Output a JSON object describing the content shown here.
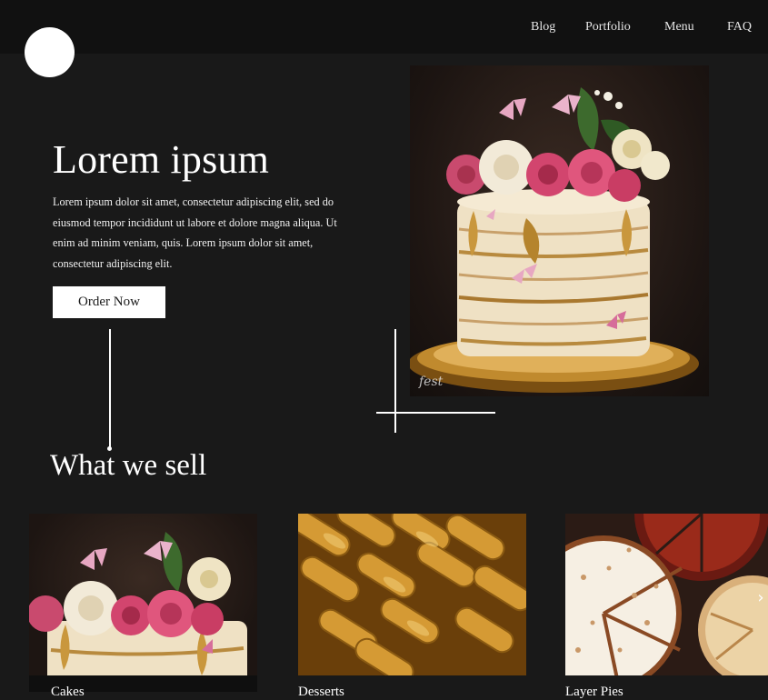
{
  "nav": {
    "items": [
      {
        "label": "Blog"
      },
      {
        "label": "Portfolio"
      },
      {
        "label": "Menu"
      },
      {
        "label": "FAQ"
      }
    ]
  },
  "hero": {
    "title": "Lorem ipsum",
    "description": "Lorem ipsum dolor sit amet, consectetur adipiscing elit, sed do eiusmod tempor incididunt ut labore et dolore magna aliqua. Ut enim ad minim  veniam, quis. Lorem ipsum dolor sit amet, consectetur adipiscing elit.",
    "cta_label": "Order Now",
    "image_signature": "fest"
  },
  "section": {
    "title": "What we sell"
  },
  "products": [
    {
      "label": "Cakes",
      "image": "floral-cake"
    },
    {
      "label": "Desserts",
      "image": "gold-chocolates"
    },
    {
      "label": "Layer Pies",
      "image": "sliced-pies"
    }
  ],
  "carousel": {
    "next_icon": "chevron-right-icon"
  },
  "colors": {
    "background": "#191919",
    "topbar": "#111111",
    "text": "#ffffff",
    "accent_gold": "#c89a3c"
  }
}
